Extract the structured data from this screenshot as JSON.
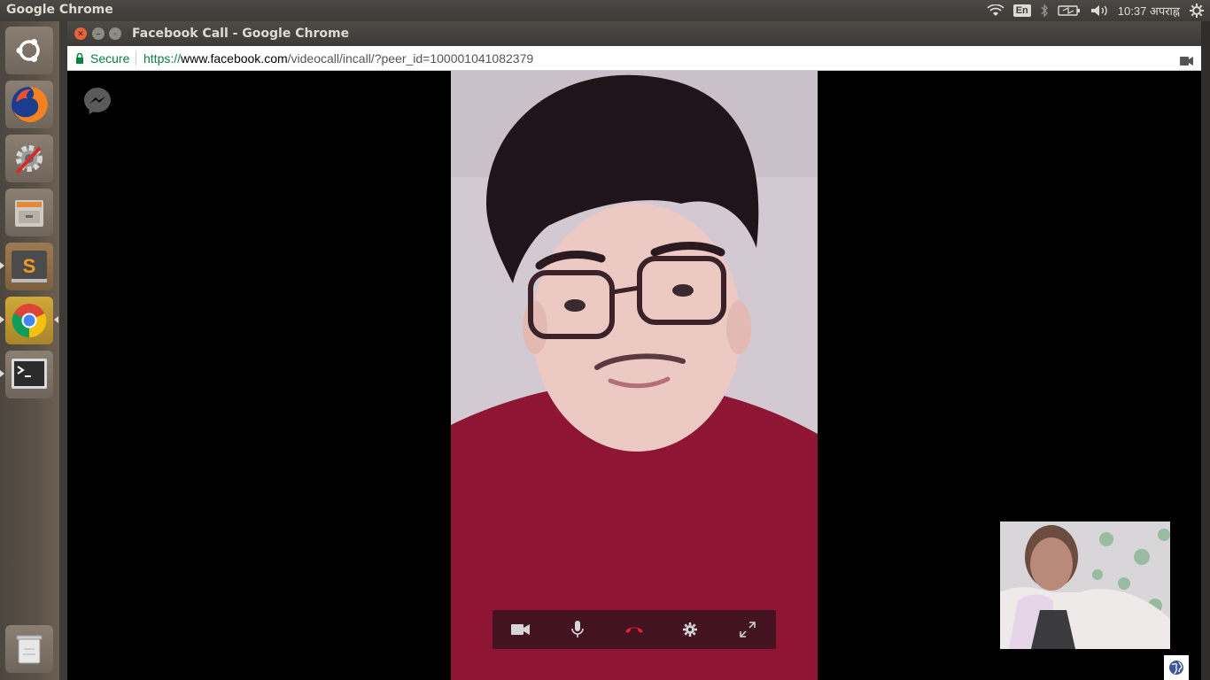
{
  "top_panel": {
    "app_title": "Google Chrome",
    "keyboard_layout": "En",
    "clock": "10:37 अपराह्न",
    "icons": [
      "wifi-icon",
      "bluetooth-icon",
      "battery-icon",
      "volume-icon",
      "settings-icon"
    ]
  },
  "launcher": {
    "items": [
      "ubuntu-dash",
      "firefox",
      "system-settings",
      "files",
      "sublime-text",
      "google-chrome",
      "terminal",
      "trash"
    ]
  },
  "window": {
    "title": "Facebook Call - Google Chrome",
    "secure_label": "Secure",
    "url_scheme": "https://",
    "url_host": "www.facebook.com",
    "url_path": "/videocall/incall/?peer_id=100001041082379"
  },
  "call": {
    "controls": [
      "video-camera-icon",
      "microphone-icon",
      "end-call-icon",
      "settings-gear-icon",
      "fullscreen-icon"
    ],
    "colors": {
      "end_call": "#e0262b",
      "controls_bg": "#2a1a20"
    }
  }
}
